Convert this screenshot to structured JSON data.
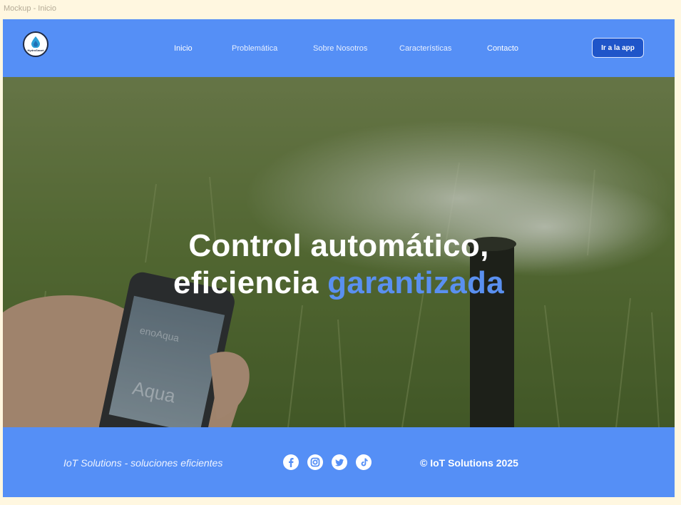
{
  "frame": {
    "label": "Mockup - Inicio"
  },
  "nav": {
    "logo_text": "HydroSmart",
    "links": [
      "Inicio",
      "Problemática",
      "Sobre Nosotros",
      "Características",
      "Contacto"
    ],
    "cta_label": "Ir a la app"
  },
  "hero": {
    "line1": "Control automático,",
    "line2_prefix": "eficiencia ",
    "line2_accent": "garantizada",
    "phone_text": "Aqua"
  },
  "footer": {
    "tagline": "IoT Solutions - soluciones eficientes",
    "social": [
      "facebook-icon",
      "instagram-icon",
      "twitter-icon",
      "tiktok-icon"
    ],
    "copyright": "© IoT Solutions 2025"
  },
  "colors": {
    "brand_blue": "#558ff6",
    "accent_blue": "#5a90f0",
    "button_blue": "#1f55c9"
  }
}
